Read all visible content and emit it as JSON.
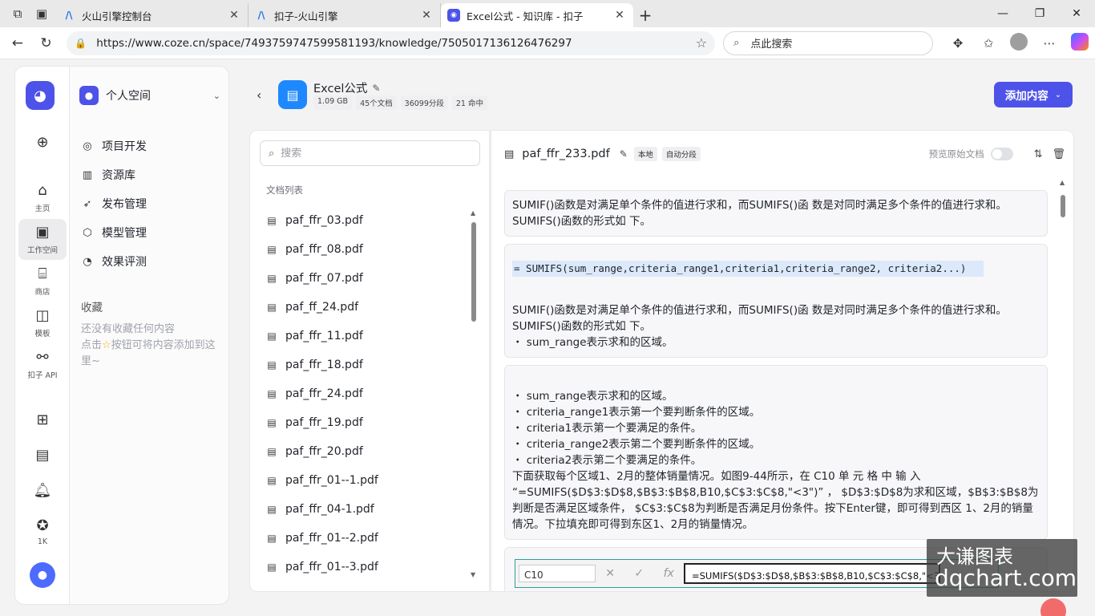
{
  "browser": {
    "tabs": [
      {
        "label": "火山引擎控制台",
        "active": false
      },
      {
        "label": "扣子-火山引擎",
        "active": false
      },
      {
        "label": "Excel公式 - 知识库 - 扣子",
        "active": true
      }
    ],
    "url": "https://www.coze.cn/space/7493759747599581193/knowledge/7505017136126476297",
    "search_placeholder": "点此搜索"
  },
  "rail": {
    "items": [
      {
        "label": "主页",
        "icon": "home-icon"
      },
      {
        "label": "工作空间",
        "icon": "workspace-icon",
        "active": true
      },
      {
        "label": "商店",
        "icon": "store-icon"
      },
      {
        "label": "模板",
        "icon": "template-icon"
      },
      {
        "label": "扣子 API",
        "icon": "api-icon"
      }
    ],
    "badge_count": "1K"
  },
  "sidebar": {
    "space_name": "个人空间",
    "menu": [
      "项目开发",
      "资源库",
      "发布管理",
      "模型管理",
      "效果评测"
    ],
    "favorites_title": "收藏",
    "favorites_empty_1": "还没有收藏任何内容",
    "favorites_empty_2": "点击",
    "favorites_empty_3": "按钮可将内容添加到这里~"
  },
  "knowledge": {
    "title": "Excel公式",
    "tags": [
      "1.09 GB",
      "45个文档",
      "36099分段",
      "21 命中"
    ],
    "add_button": "添加内容"
  },
  "doclist": {
    "search_placeholder": "搜索",
    "title": "文档列表",
    "items": [
      "paf_ffr_03.pdf",
      "paf_ffr_08.pdf",
      "paf_ffr_07.pdf",
      "paf_ff_24.pdf",
      "paf_ffr_11.pdf",
      "paf_ffr_18.pdf",
      "paf_ffr_24.pdf",
      "paf_ffr_19.pdf",
      "paf_ffr_20.pdf",
      "paf_ffr_01--1.pdf",
      "paf_ffr_04-1.pdf",
      "paf_ffr_01--2.pdf",
      "paf_ffr_01--3.pdf"
    ]
  },
  "viewer": {
    "filename": "paf_ffr_233.pdf",
    "tags": [
      "本地",
      "自动分段"
    ],
    "preview_label": "预览原始文档",
    "chunk1": "SUMIF()函数是对满足单个条件的值进行求和，而SUMIFS()函 数是对同时满足多个条件的值进行求和。SUMIFS()函数的形式如 下。",
    "chunk2_formula": "= SUMIFS(sum_range,criteria_range1,criteria1,criteria_range2, criteria2...)",
    "chunk2_text": "SUMIF()函数是对满足单个条件的值进行求和，而SUMIFS()函 数是对同时满足多个条件的值进行求和。SUMIFS()函数的形式如 下。",
    "chunk2_bullet": "・ sum_range表示求和的区域。",
    "chunk3_lines": [
      "・ sum_range表示求和的区域。",
      "・ criteria_range1表示第一个要判断条件的区域。",
      "・ criteria1表示第一个要满足的条件。",
      "・ criteria_range2表示第二个要判断条件的区域。",
      "・ criteria2表示第二个要满足的条件。"
    ],
    "chunk3_para": "下面获取每个区域1、2月的整体销量情况。如图9-44所示，在 C10 单 元 格 中 输 入 “=SUMIFS($D$3:$D$8,$B$3:$B$8,B10,$C$3:$C$8,\"<3\")” ， $D$3:$D$8为求和区域，$B$3:$B$8为判断是否满足区域条件， $C$3:$C$8为判断是否满足月份条件。按下Enter键，即可得到西区 1、2月的销量情况。下拉填充即可得到东区1、2月的销量情况。",
    "excel_cell": "C10",
    "excel_formula": "=SUMIFS($D$3:$D$8,$B$3:$B$8,B10,$C$3:$C$8,\"<3\")"
  },
  "watermark": {
    "line1": "大谦图表",
    "line2": "dqchart.com"
  }
}
